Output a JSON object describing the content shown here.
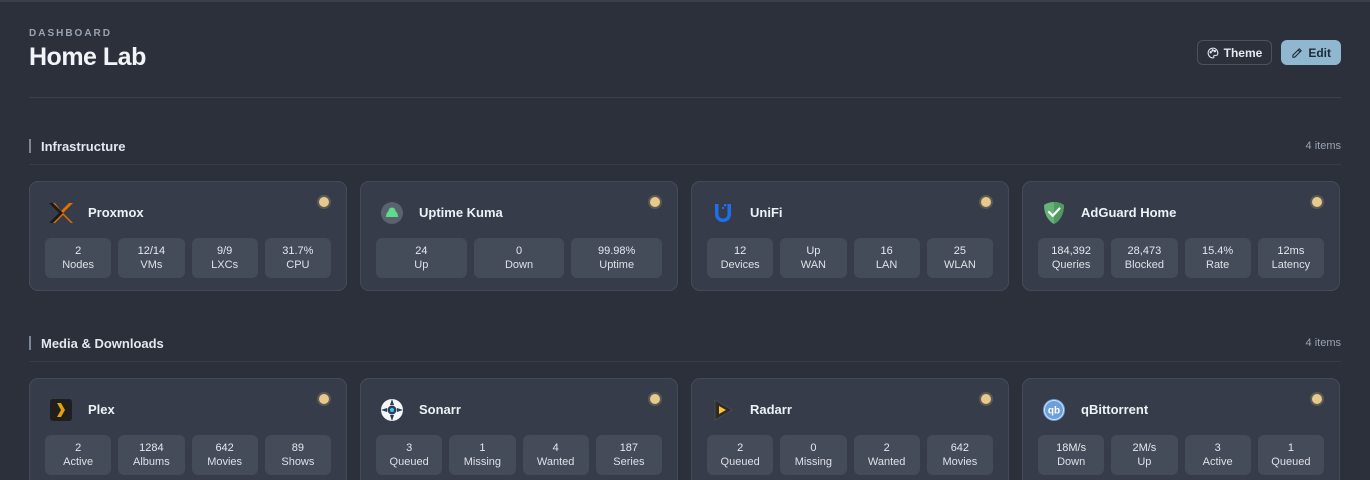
{
  "header": {
    "eyebrow": "DASHBOARD",
    "title": "Home Lab",
    "theme_label": "Theme",
    "edit_label": "Edit"
  },
  "sections": [
    {
      "label": "Infrastructure",
      "count": "4 items",
      "cards": [
        {
          "name": "Proxmox",
          "icon": "proxmox-icon",
          "stats": [
            {
              "v": "2",
              "l": "Nodes"
            },
            {
              "v": "12/14",
              "l": "VMs"
            },
            {
              "v": "9/9",
              "l": "LXCs"
            },
            {
              "v": "31.7%",
              "l": "CPU"
            }
          ]
        },
        {
          "name": "Uptime Kuma",
          "icon": "uptime-kuma-icon",
          "stats": [
            {
              "v": "24",
              "l": "Up"
            },
            {
              "v": "0",
              "l": "Down"
            },
            {
              "v": "99.98%",
              "l": "Uptime"
            }
          ]
        },
        {
          "name": "UniFi",
          "icon": "unifi-icon",
          "stats": [
            {
              "v": "12",
              "l": "Devices"
            },
            {
              "v": "Up",
              "l": "WAN"
            },
            {
              "v": "16",
              "l": "LAN"
            },
            {
              "v": "25",
              "l": "WLAN"
            }
          ]
        },
        {
          "name": "AdGuard Home",
          "icon": "adguard-icon",
          "stats": [
            {
              "v": "184,392",
              "l": "Queries"
            },
            {
              "v": "28,473",
              "l": "Blocked"
            },
            {
              "v": "15.4%",
              "l": "Rate"
            },
            {
              "v": "12ms",
              "l": "Latency"
            }
          ]
        }
      ]
    },
    {
      "label": "Media & Downloads",
      "count": "4 items",
      "cards": [
        {
          "name": "Plex",
          "icon": "plex-icon",
          "stats": [
            {
              "v": "2",
              "l": "Active"
            },
            {
              "v": "1284",
              "l": "Albums"
            },
            {
              "v": "642",
              "l": "Movies"
            },
            {
              "v": "89",
              "l": "Shows"
            }
          ]
        },
        {
          "name": "Sonarr",
          "icon": "sonarr-icon",
          "stats": [
            {
              "v": "3",
              "l": "Queued"
            },
            {
              "v": "1",
              "l": "Missing"
            },
            {
              "v": "4",
              "l": "Wanted"
            },
            {
              "v": "187",
              "l": "Series"
            }
          ]
        },
        {
          "name": "Radarr",
          "icon": "radarr-icon",
          "stats": [
            {
              "v": "2",
              "l": "Queued"
            },
            {
              "v": "0",
              "l": "Missing"
            },
            {
              "v": "2",
              "l": "Wanted"
            },
            {
              "v": "642",
              "l": "Movies"
            }
          ]
        },
        {
          "name": "qBittorrent",
          "icon": "qbittorrent-icon",
          "stats": [
            {
              "v": "18M/s",
              "l": "Down"
            },
            {
              "v": "2M/s",
              "l": "Up"
            },
            {
              "v": "3",
              "l": "Active"
            },
            {
              "v": "1",
              "l": "Queued"
            }
          ]
        }
      ]
    }
  ],
  "colors": {
    "status_dot": "#e7c98d",
    "accent": "#8fb7cf"
  }
}
